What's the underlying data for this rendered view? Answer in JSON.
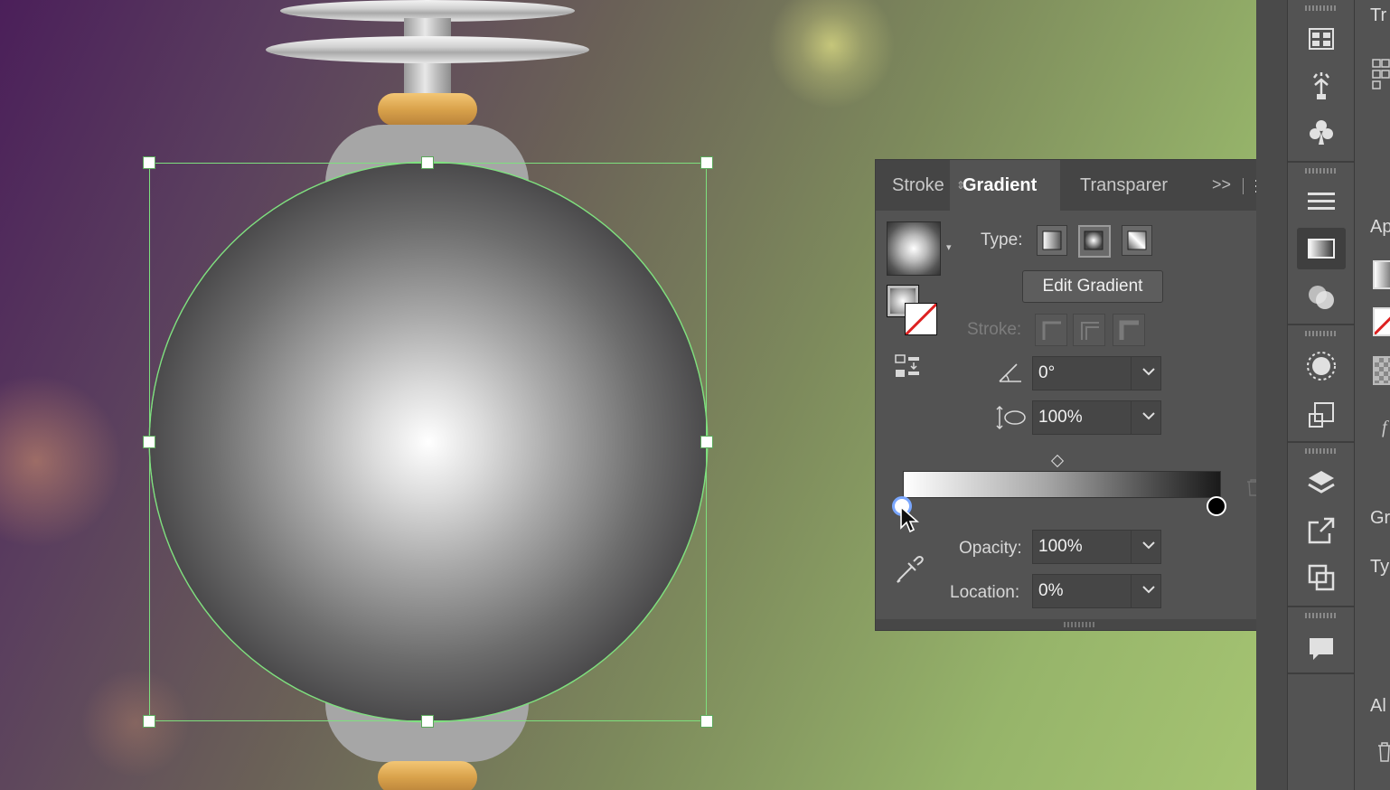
{
  "panel": {
    "tabs": [
      "Stroke",
      "Gradient",
      "Transparer"
    ],
    "active_tab": "Gradient",
    "overflow_label": ">>",
    "type_label": "Type:",
    "edit_gradient_label": "Edit Gradient",
    "stroke_label": "Stroke:",
    "angle_value": "0°",
    "aspect_value": "100%",
    "opacity_label": "Opacity:",
    "opacity_value": "100%",
    "location_label": "Location:",
    "location_value": "0%"
  },
  "dock_cut_labels": [
    "Tr",
    "Ap",
    "Gr",
    "Ty",
    "Al"
  ],
  "icons": {
    "gradient_types": [
      "linear-gradient-icon",
      "radial-gradient-icon",
      "freeform-gradient-icon"
    ],
    "dock": [
      "libraries-icon",
      "symbols-icon",
      "club-icon",
      "align-icon",
      "gradient-panel-icon",
      "transparency-icon",
      "appearance-icon",
      "transform-icon",
      "layers-icon",
      "export-icon",
      "artboards-icon",
      "comments-icon"
    ]
  },
  "colors": {
    "selection": "#7ee07e",
    "panel_bg": "#535353",
    "active_stop": "#7aa7ff"
  }
}
